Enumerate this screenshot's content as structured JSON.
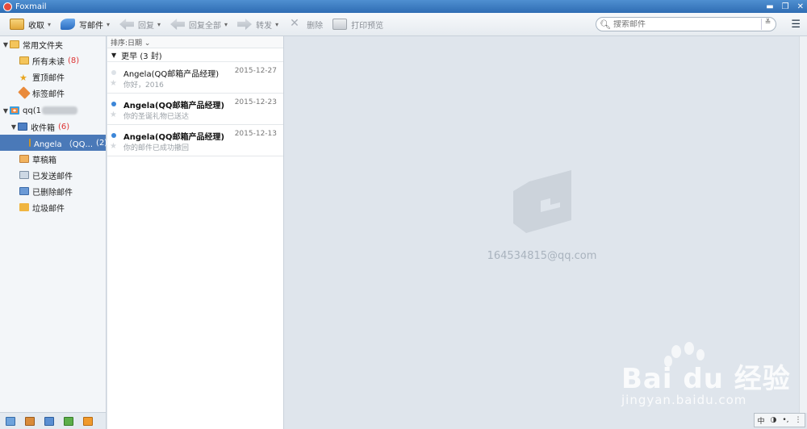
{
  "window": {
    "title": "Foxmail",
    "minimize": "▬",
    "restore": "❐",
    "close": "✕"
  },
  "toolbar": {
    "receive": "收取",
    "compose": "写邮件",
    "reply": "回复",
    "reply_all": "回复全部",
    "forward": "转发",
    "delete": "删除",
    "print_preview": "打印预览",
    "search_placeholder": "搜索邮件",
    "dropdown_caret": "▾",
    "search_drop": "≚",
    "menu_icon": "☰"
  },
  "sidebar": {
    "favorites": {
      "label": "常用文件夹",
      "items": [
        {
          "label": "所有未读",
          "count": "(8)"
        },
        {
          "label": "置顶邮件",
          "count": ""
        },
        {
          "label": "标签邮件",
          "count": ""
        }
      ]
    },
    "account": {
      "label": "qq(1",
      "folders": [
        {
          "label": "收件箱",
          "count": "(6)"
        },
        {
          "label": "Angela （QQ...",
          "count": "(2)"
        },
        {
          "label": "草稿箱",
          "count": ""
        },
        {
          "label": "已发送邮件",
          "count": ""
        },
        {
          "label": "已删除邮件",
          "count": ""
        },
        {
          "label": "垃圾邮件",
          "count": ""
        }
      ]
    }
  },
  "message_list": {
    "sort_label": "排序:日期 ⌄",
    "group_label": "更早 (3 封)",
    "messages": [
      {
        "from": "Angela(QQ邮箱产品经理)",
        "date": "2015-12-27",
        "preview": "你好，2016",
        "unread": false
      },
      {
        "from": "Angela(QQ邮箱产品经理)",
        "date": "2015-12-23",
        "preview": "你的圣诞礼物已送达",
        "unread": true
      },
      {
        "from": "Angela(QQ邮箱产品经理)",
        "date": "2015-12-13",
        "preview": "你的邮件已成功撤回",
        "unread": true
      }
    ]
  },
  "reader": {
    "account_email": "164534815@qq.com"
  },
  "watermark": {
    "brand": "Bai du 经验",
    "site": "jingyan.baidu.com"
  },
  "ime": {
    "label": "中",
    "moon": "◑",
    "punct": "•,",
    "dots": "⋮"
  }
}
